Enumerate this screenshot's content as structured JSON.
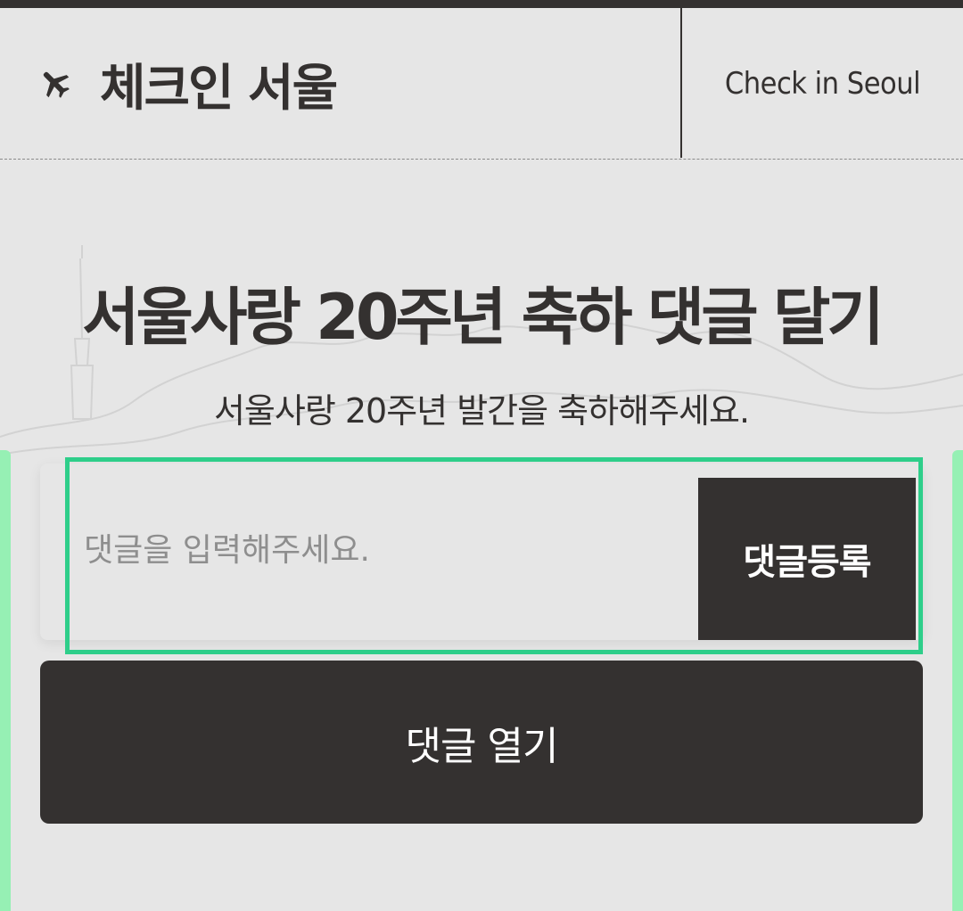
{
  "header": {
    "brand_title": "체크인 서울",
    "english_title": "Check in Seoul"
  },
  "main": {
    "title": "서울사랑 20주년 축하 댓글 달기",
    "subtitle": "서울사랑 20주년 발간을 축하해주세요."
  },
  "comment_form": {
    "placeholder": "댓글을 입력해주세요.",
    "submit_label": "댓글등록",
    "focus_color": "#2ece8a"
  },
  "open_comments_label": "댓글 열기",
  "colors": {
    "background": "#e6e6e6",
    "dark": "#343130",
    "accent_green": "#96f0b4"
  },
  "icons": {
    "brand": "airplane-icon"
  }
}
